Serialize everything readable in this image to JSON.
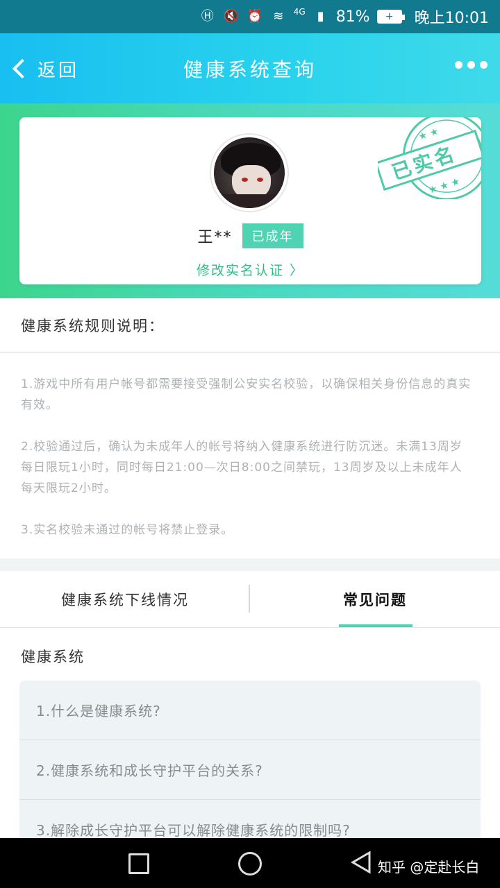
{
  "status_bar": {
    "network": "4G",
    "battery": "81%",
    "time": "晚上10:01"
  },
  "header": {
    "back_label": "返回",
    "title": "健康系统查询"
  },
  "profile": {
    "name": "王**",
    "badge": "已成年",
    "edit_link": "修改实名认证 〉",
    "stamp_text": "已实名"
  },
  "rules": {
    "heading": "健康系统规则说明：",
    "items": [
      "1.游戏中所有用户帐号都需要接受强制公安实名校验，以确保相关身份信息的真实有效。",
      "2.校验通过后，确认为未成年人的帐号将纳入健康系统进行防沉迷。未满13周岁每日限玩1小时，同时每日21:00—次日8:00之间禁玩，13周岁及以上未成年人每天限玩2小时。",
      "3.实名校验未通过的帐号将禁止登录。"
    ]
  },
  "tabs": [
    {
      "label": "健康系统下线情况"
    },
    {
      "label": "常见问题"
    }
  ],
  "faq": {
    "heading": "健康系统",
    "items": [
      "1.什么是健康系统?",
      "2.健康系统和成长守护平台的关系?",
      "3.解除成长守护平台可以解除健康系统的限制吗?"
    ]
  },
  "watermark": "知乎 @定赴长白",
  "colors": {
    "status_bar": "#117a8f",
    "header_gradient_start": "#18bff0",
    "accent_green": "#4fd3b2",
    "link_green": "#2dbb86"
  }
}
